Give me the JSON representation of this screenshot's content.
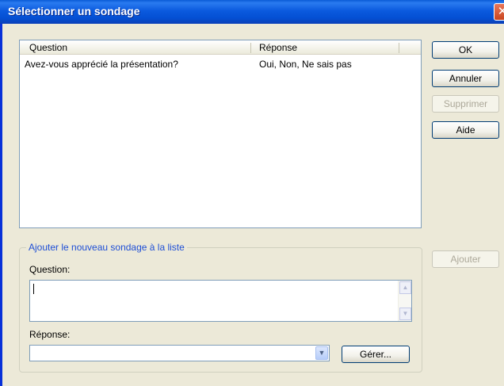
{
  "window": {
    "title": "Sélectionner un sondage",
    "close_glyph": "✕"
  },
  "list": {
    "columns": [
      "Question",
      "Réponse"
    ],
    "rows": [
      {
        "question": "Avez-vous apprécié la présentation?",
        "response": "Oui, Non, Ne sais pas"
      }
    ]
  },
  "buttons": {
    "ok": "OK",
    "cancel": "Annuler",
    "delete": "Supprimer",
    "help": "Aide",
    "add": "Ajouter",
    "manage": "Gérer..."
  },
  "group": {
    "legend": "Ajouter le nouveau sondage à la liste",
    "question_label": "Question:",
    "question_value": "",
    "response_label": "Réponse:",
    "response_value": ""
  },
  "colors": {
    "accent": "#0831d9",
    "legend": "#1f4fd6",
    "dialog_bg": "#ece9d8"
  }
}
